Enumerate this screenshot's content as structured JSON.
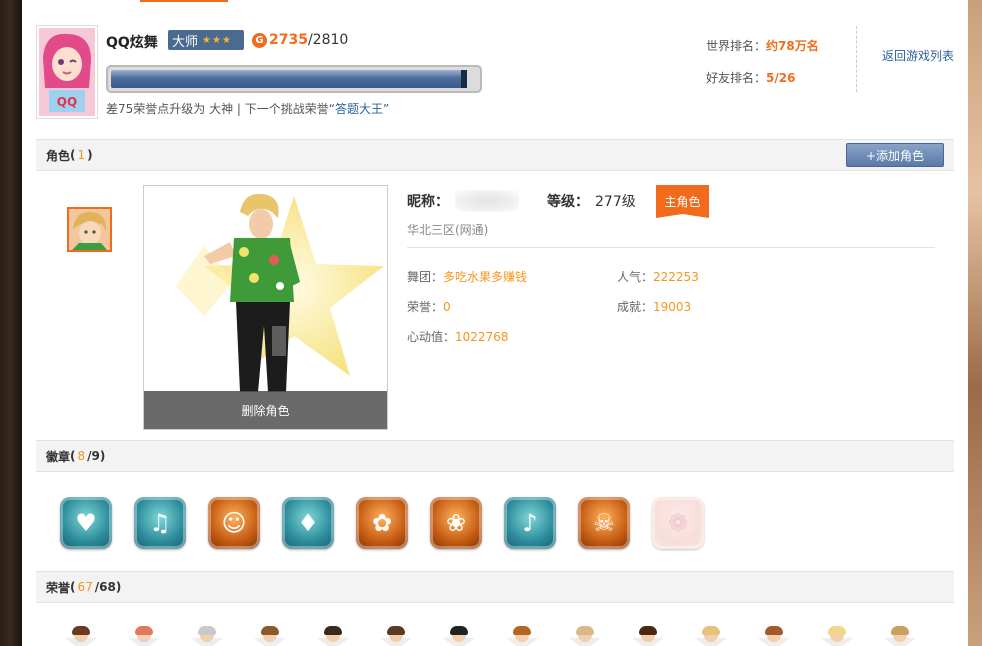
{
  "header": {
    "game_name": "QQ炫舞",
    "rank_title": "大师",
    "rank_stars": "★★★",
    "honor_icon_letter": "G",
    "honor_current": "2735",
    "honor_total": "/2810",
    "honor_progress": 0.973,
    "upgrade_tip_prefix": "差75荣誉点升级为 大神 | 下一个挑战荣誉",
    "upgrade_tip_link": "“答题大王”",
    "world_rank_label": "世界排名：",
    "world_rank_value": "约78万名",
    "friend_rank_label": "好友排名：",
    "friend_rank_value": "5/26",
    "back_link": "返回游戏列表"
  },
  "roles": {
    "title": "角色",
    "open": "(",
    "count": "1",
    "close": ")",
    "add_button": "+添加角色",
    "delete_label": "删除角色",
    "nickname_label": "昵称：",
    "level_label": "等级：",
    "level_value": "277级",
    "main_tag": "主角色",
    "server": "华北三区(网通)",
    "dance_group_label": "舞团：",
    "dance_group_value": "多吃水果多赚钱",
    "popularity_label": "人气：",
    "popularity_value": "222253",
    "honor_label": "荣誉：",
    "honor_value": "0",
    "achievement_label": "成就：",
    "achievement_value": "19003",
    "heart_label": "心动值：",
    "heart_value": "1022768"
  },
  "badges": {
    "title": "徽章",
    "open": "(",
    "earned": "8",
    "total": "/9",
    "close": ")",
    "items": [
      {
        "icon": "heart-badge-icon",
        "style": "teal"
      },
      {
        "icon": "music-wing-badge-icon",
        "style": "teal"
      },
      {
        "icon": "character-badge-icon",
        "style": "orange"
      },
      {
        "icon": "hat-badge-icon",
        "style": "teal"
      },
      {
        "icon": "bow-badge-icon",
        "style": "orange"
      },
      {
        "icon": "bunny-badge-icon",
        "style": "orange"
      },
      {
        "icon": "microphone-badge-icon",
        "style": "teal"
      },
      {
        "icon": "skull-badge-icon",
        "style": "orange"
      },
      {
        "icon": "rose-badge-icon",
        "style": "faded"
      }
    ]
  },
  "honors": {
    "title": "荣誉",
    "open": "(",
    "earned": "67",
    "total": "/68",
    "close": ")",
    "hair_colors": [
      "#6b3b1d",
      "#e07a5f",
      "#c9c9c9",
      "#8b5a2b",
      "#3a2a1e",
      "#5a3a22",
      "#222222",
      "#b5651d",
      "#d8b88a",
      "#4a2a12",
      "#e8c27a",
      "#a05a2c",
      "#f0d58a",
      "#c8a060"
    ]
  },
  "colors": {
    "accent": "#f26b1d",
    "value": "#f7941d",
    "link": "#2b5f9e",
    "button": "#5c7aa6"
  }
}
